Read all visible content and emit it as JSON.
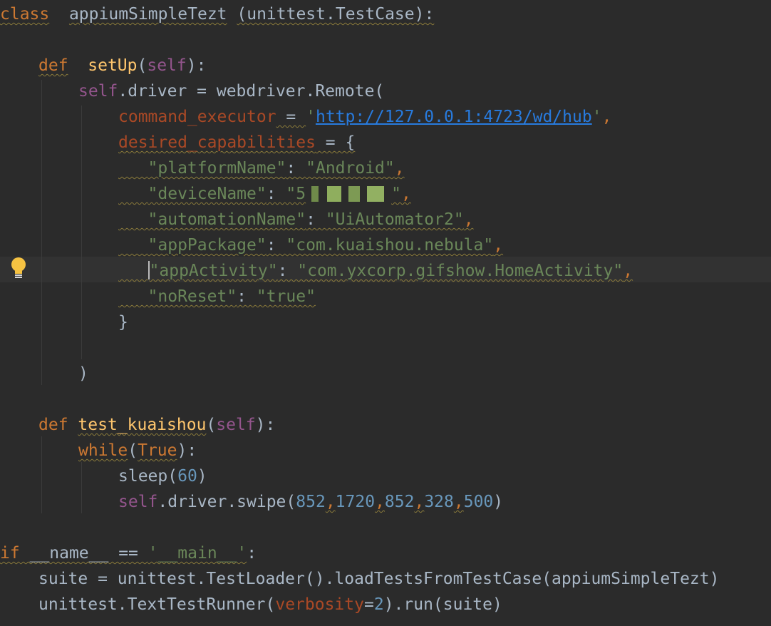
{
  "editor": {
    "class_kw": "class",
    "class_name": "appiumSimpleTezt",
    "class_base": "(unittest.TestCase):",
    "def_kw": "def",
    "setup_name": "setUp",
    "self_word": "self",
    "setup_tail": "):",
    "driver_assign": ".driver = webdriver.Remote(",
    "cmd_param": "command_executor",
    "eq": " = ",
    "quote": "'",
    "url": "http://127.0.0.1:4723/wd/hub",
    "comma": ",",
    "caps_param": "desired_capabilities",
    "brace_open": " = {",
    "caps": [
      {
        "key": "\"platformName\"",
        "value": "\"Android\""
      },
      {
        "key": "\"deviceName\"",
        "value": "\"5"
      },
      {
        "key": "\"automationName\"",
        "value": "\"UiAutomator2\""
      },
      {
        "key": "\"appPackage\"",
        "value": "\"com.kuaishou.nebula\""
      },
      {
        "key": "\"appActivity\"",
        "value": "\"com.yxcorp.gifshow.HomeActivity\""
      },
      {
        "key": "\"noReset\"",
        "value": "\"true\""
      }
    ],
    "colon": ": ",
    "device_tail": "\"",
    "brace_close": "}",
    "paren_close": ")",
    "test_name": "test_kuaishou",
    "while_kw": "while",
    "true_kw": "True",
    "sleep_call": "sleep(",
    "sleep_arg": "60",
    "swipe_call": ".driver.swipe(",
    "swipe_args": [
      "852",
      "1720",
      "852",
      "328",
      "500"
    ],
    "if_kw": "if",
    "name_var": "__name__",
    "eqeq": " == ",
    "main_str": "'__main__'",
    "main_tail": ":",
    "suite_line": "suite = unittest.TestLoader().loadTestsFromTestCase(appiumSimpleTezt)",
    "runner_start": "unittest.TextTestRunner(",
    "verbosity_param": "verbosity",
    "verbosity_eq": "=",
    "verbosity_val": "2",
    "runner_end": ").run(suite)"
  }
}
